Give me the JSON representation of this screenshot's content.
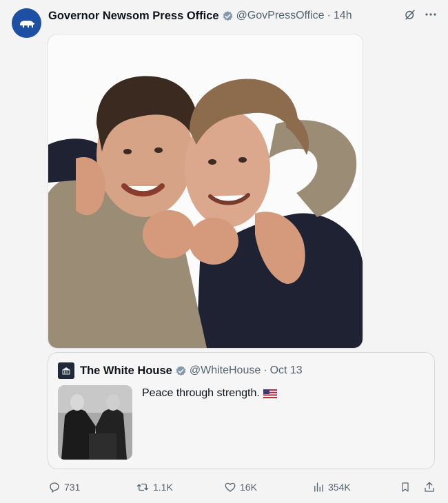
{
  "post": {
    "author_name": "Governor Newsom Press Office",
    "handle": "@GovPressOffice",
    "separator": "·",
    "time": "14h",
    "avatar_icon": "bear-icon",
    "verified_icon": "verified-badge-icon"
  },
  "quote": {
    "author_name": "The White House",
    "handle": "@WhiteHouse",
    "separator": "·",
    "date": "Oct 13",
    "text": "Peace through strength.",
    "flag_icon": "us-flag-icon"
  },
  "actions": {
    "replies": "731",
    "reposts": "1.1K",
    "likes": "16K",
    "views": "354K"
  },
  "colors": {
    "avatar_bg": "#1d4fa3",
    "verified": "#829aab",
    "muted_text": "#536471"
  }
}
